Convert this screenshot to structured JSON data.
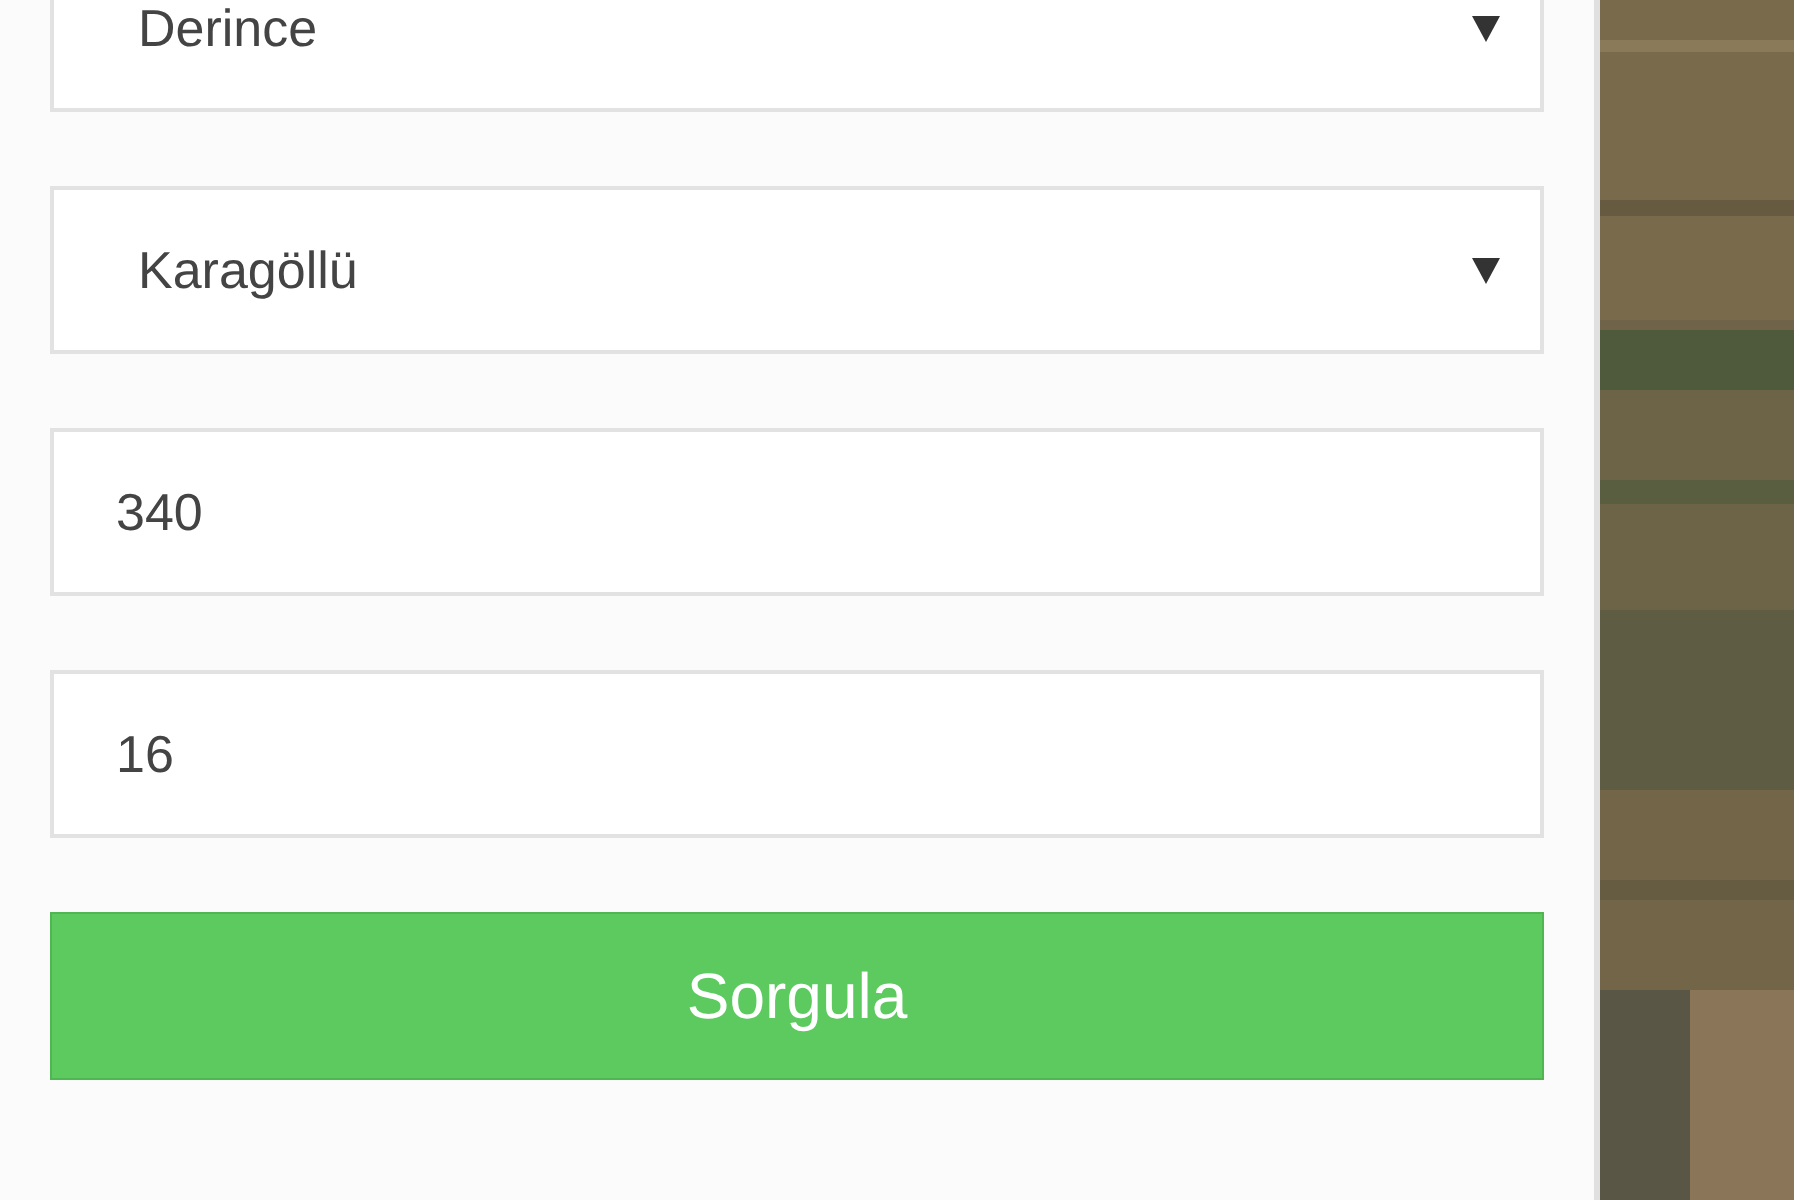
{
  "selects": [
    {
      "value": "Derince"
    },
    {
      "value": "Karagöllü"
    }
  ],
  "inputs": [
    {
      "value": "340"
    },
    {
      "value": "16"
    }
  ],
  "button": {
    "label": "Sorgula"
  }
}
